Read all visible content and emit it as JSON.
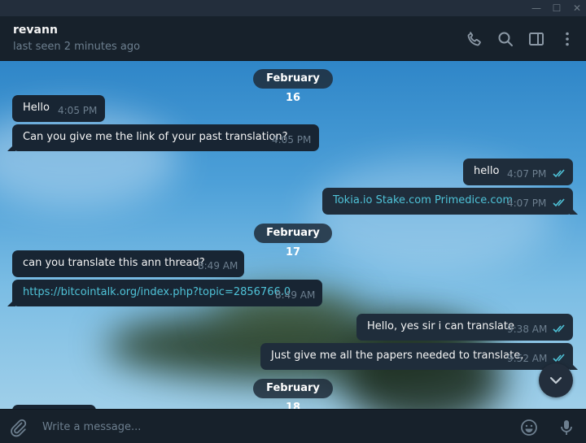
{
  "window": {
    "minimize_glyph": "—",
    "maximize_glyph": "☐",
    "close_glyph": "✕"
  },
  "header": {
    "peer_name": "revann",
    "peer_status": "last seen 2 minutes ago",
    "icons": [
      "phone-icon",
      "search-icon",
      "sidebar-toggle-icon",
      "more-vertical-icon"
    ]
  },
  "chat": {
    "dates": [
      "February 16",
      "February 17",
      "February 18"
    ],
    "messages": [
      {
        "dir": "in",
        "text": "Hello",
        "time": "4:05 PM"
      },
      {
        "dir": "in",
        "text": "Can you give me the link of your past translation?",
        "time": "4:05 PM"
      },
      {
        "dir": "out",
        "text": "hello",
        "time": "4:07 PM",
        "read": true
      },
      {
        "dir": "out",
        "text": "Tokia.io Stake.com Primedice.com",
        "time": "4:07 PM",
        "read": true,
        "link": true
      },
      {
        "dir": "in",
        "text": "can you translate this ann thread?",
        "time": "8:49 AM"
      },
      {
        "dir": "in",
        "text": "https://bitcointalk.org/index.php?topic=2856766.0",
        "time": "8:49 AM",
        "link": true
      },
      {
        "dir": "out",
        "text": "Hello, yes sir i can translate",
        "time": "9:38 AM",
        "read": true
      },
      {
        "dir": "out",
        "text": "Just give me all the papers needed to translate,",
        "time": "9:52 AM",
        "read": true
      }
    ]
  },
  "composer": {
    "placeholder": "Write a message...",
    "value": ""
  },
  "colors": {
    "app_bg": "#17212b",
    "bubble_in": "#182533",
    "bubble_out": "#1f2d3b",
    "link": "#4fc3d8",
    "check": "#4fc3d8",
    "muted": "#6d7f8f"
  }
}
